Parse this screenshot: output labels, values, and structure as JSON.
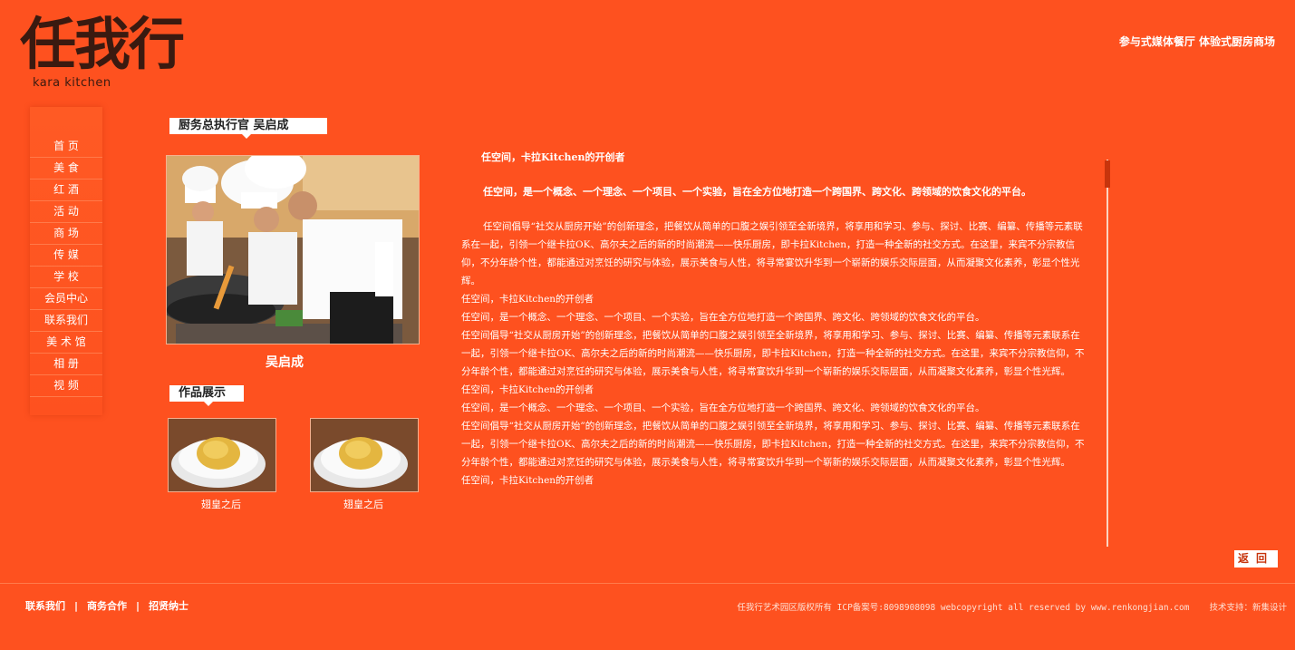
{
  "brand": {
    "logo_cn": "任我行",
    "logo_en": "kara kitchen",
    "tagline": "参与式媒体餐厅  体验式厨房商场"
  },
  "sidenav": {
    "items": [
      "首  页",
      "美  食",
      "红  酒",
      "活  动",
      "商  场",
      "传  媒",
      "学  校",
      "会员中心",
      "联系我们",
      "美 术 馆",
      "相  册",
      "视  频"
    ]
  },
  "chef": {
    "heading": "厨务总执行官 吴启成",
    "name": "吴启成"
  },
  "works": {
    "heading": "作品展示",
    "items": [
      {
        "caption": "翅皇之后"
      },
      {
        "caption": "翅皇之后"
      }
    ]
  },
  "article": {
    "title": "任空间，卡拉Kitchen的开创者",
    "intro": "任空间，是一个概念、一个理念、一个项目、一个实验，旨在全方位地打造一个跨国界、跨文化、跨领域的饮食文化的平台。",
    "lead": "任空间倡导“社交从厨房开始”的创新理念，把餐饮从简单的口腹之娱引领至全新境界，将享用和学习、参与、探讨、比赛、编纂、传播等元素联系在一起，引领一个继卡拉OK、高尔夫之后的新的时尚潮流——快乐厨房，即卡拉Kitchen，打造一种全新的社交方式。在这里，来宾不分宗教信仰，不分年龄个性，都能通过对烹饪的研究与体验，展示美食与人性，将寻常宴饮升华到一个崭新的娱乐交际层面，从而凝聚文化素养，彰显个性光辉。",
    "paragraphs": [
      "任空间，卡拉Kitchen的开创者",
      "任空间，是一个概念、一个理念、一个项目、一个实验，旨在全方位地打造一个跨国界、跨文化、跨领域的饮食文化的平台。",
      "任空间倡导“社交从厨房开始”的创新理念，把餐饮从简单的口腹之娱引领至全新境界，将享用和学习、参与、探讨、比赛、编纂、传播等元素联系在一起，引领一个继卡拉OK、高尔夫之后的新的时尚潮流——快乐厨房，即卡拉Kitchen，打造一种全新的社交方式。在这里，来宾不分宗教信仰，不分年龄个性，都能通过对烹饪的研究与体验，展示美食与人性，将寻常宴饮升华到一个崭新的娱乐交际层面，从而凝聚文化素养，彰显个性光辉。",
      "任空间，卡拉Kitchen的开创者",
      "任空间，是一个概念、一个理念、一个项目、一个实验，旨在全方位地打造一个跨国界、跨文化、跨领域的饮食文化的平台。",
      "任空间倡导“社交从厨房开始”的创新理念，把餐饮从简单的口腹之娱引领至全新境界，将享用和学习、参与、探讨、比赛、编纂、传播等元素联系在一起，引领一个继卡拉OK、高尔夫之后的新的时尚潮流——快乐厨房，即卡拉Kitchen，打造一种全新的社交方式。在这里，来宾不分宗教信仰，不分年龄个性，都能通过对烹饪的研究与体验，展示美食与人性，将寻常宴饮升华到一个崭新的娱乐交际层面，从而凝聚文化素养，彰显个性光辉。",
      "任空间，卡拉Kitchen的开创者"
    ]
  },
  "back_label": "返回",
  "footer": {
    "links": [
      "联系我们",
      "商务合作",
      "招贤纳士"
    ],
    "separator": "|",
    "copyright": "任我行艺术园区版权所有 ICP备案号:8098908098 webcopyright all reserved by www.renkongjian.com",
    "support": "技术支持：新集设计"
  },
  "colors": {
    "background": "#fe511f",
    "accent_dark": "#c7340c",
    "text": "#ffffff"
  }
}
